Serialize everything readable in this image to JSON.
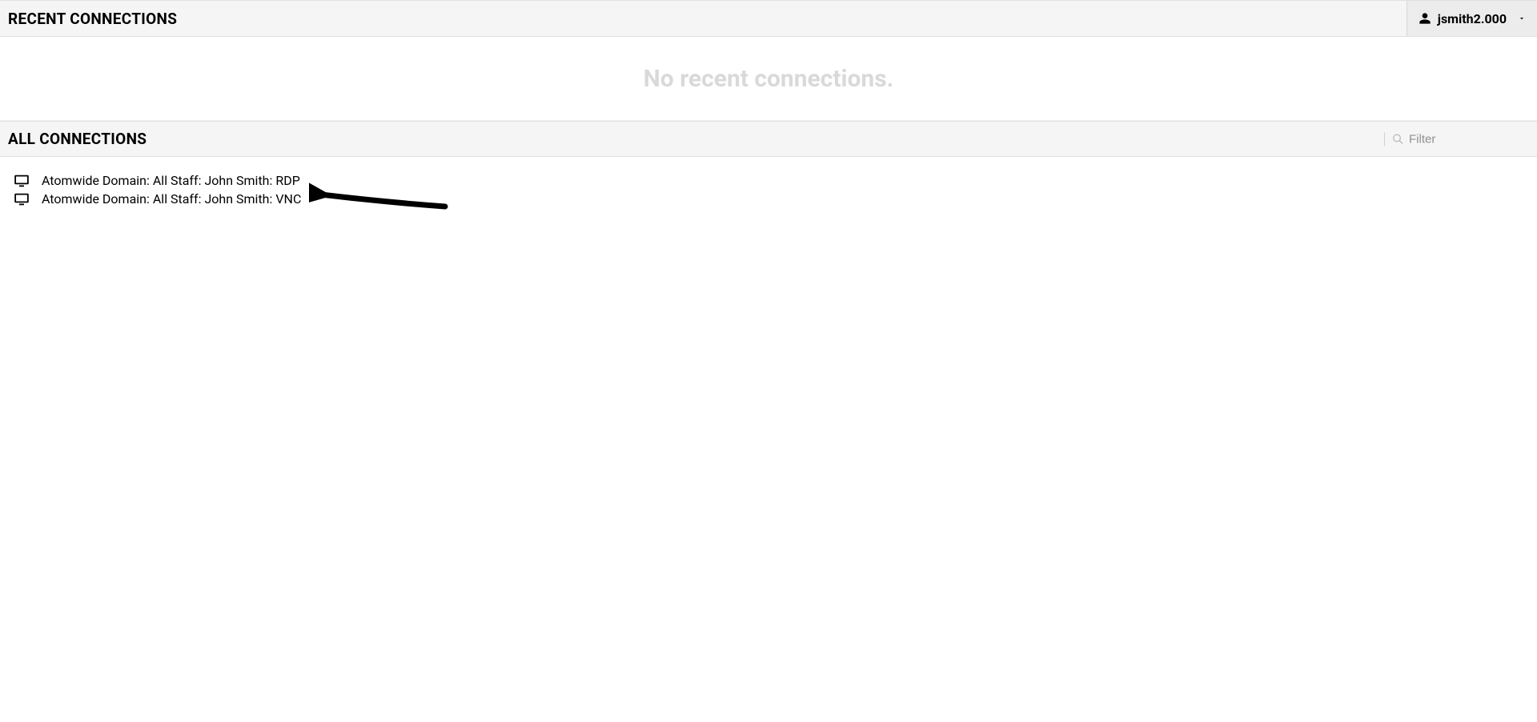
{
  "header": {
    "recent_title": "RECENT CONNECTIONS",
    "username": "jsmith2.000"
  },
  "recent": {
    "empty_message": "No recent connections."
  },
  "all": {
    "title": "ALL CONNECTIONS",
    "filter_placeholder": "Filter",
    "connections": [
      {
        "label": "Atomwide Domain: All Staff: John Smith: RDP"
      },
      {
        "label": "Atomwide Domain: All Staff: John Smith: VNC"
      }
    ]
  }
}
